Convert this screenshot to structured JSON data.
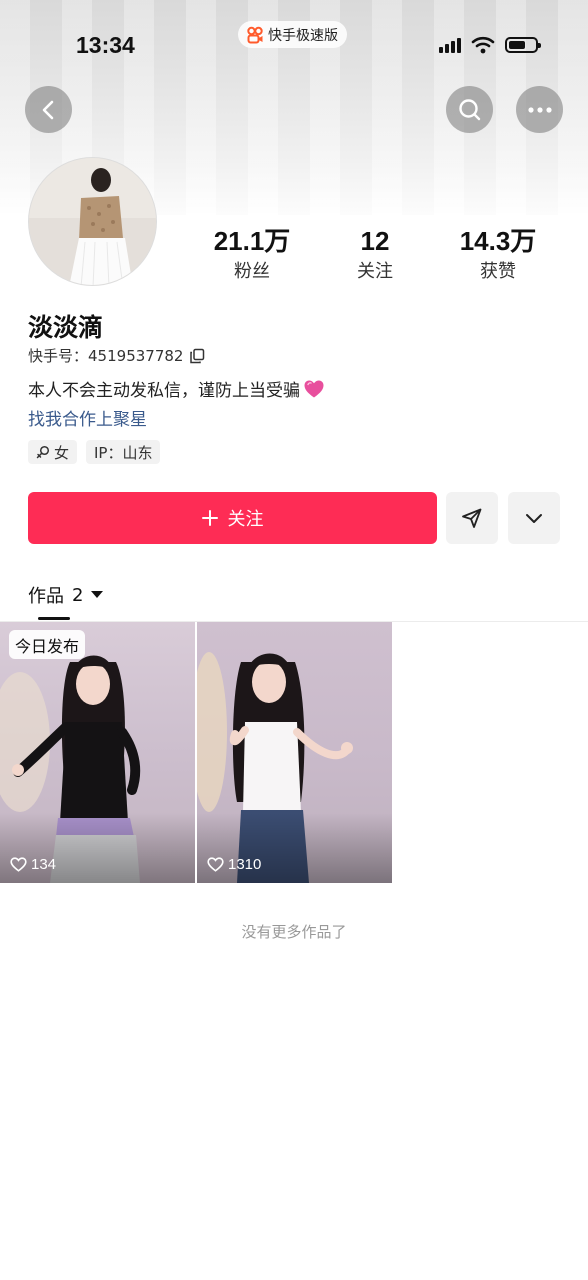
{
  "status_bar": {
    "time": "13:34",
    "app_name": "快手极速版"
  },
  "profile": {
    "nickname": "淡淡滴",
    "kuaishou_id_label": "快手号：",
    "kuaishou_id": "4519537782",
    "bio": "本人不会主动发私信，谨防上当受骗",
    "collab_link": "找我合作上聚星",
    "tags": [
      "女",
      "IP：山东"
    ]
  },
  "stats": [
    {
      "value": "21.1万",
      "label": "粉丝"
    },
    {
      "value": "12",
      "label": "关注"
    },
    {
      "value": "14.3万",
      "label": "获赞"
    }
  ],
  "actions": {
    "follow_label": "关注"
  },
  "works": {
    "tab_label": "作品",
    "count": "2",
    "items": [
      {
        "badge": "今日发布",
        "likes": "134"
      },
      {
        "badge": "",
        "likes": "1310"
      }
    ],
    "end_text": "没有更多作品了"
  },
  "colors": {
    "accent": "#fe2c55",
    "link": "#3a5a8c"
  }
}
